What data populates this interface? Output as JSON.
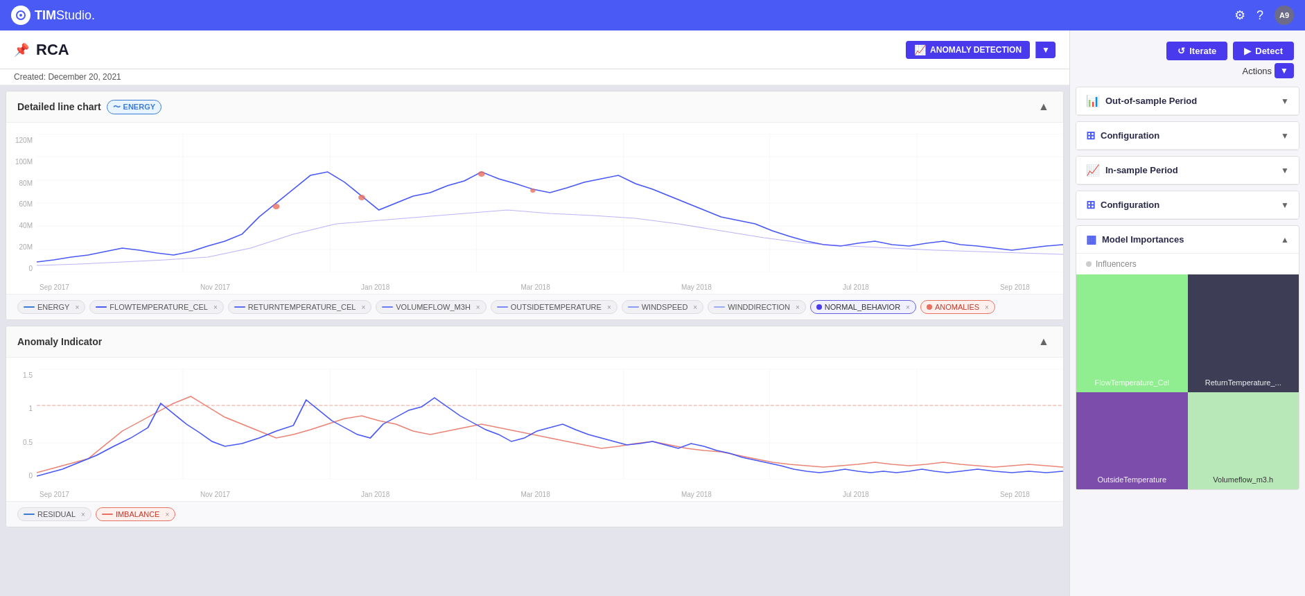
{
  "app": {
    "name": "TIM",
    "subtitle": "Studio.",
    "user_initials": "A9"
  },
  "header": {
    "title": "RCA",
    "created_label": "Created:",
    "created_date": "December 20, 2021",
    "anomaly_badge": "ANOMALY DETECTION",
    "iterate_label": "Iterate",
    "detect_label": "Detect",
    "actions_label": "Actions"
  },
  "charts": {
    "detailed_line_chart": {
      "title": "Detailed line chart",
      "tag": "ENERGY",
      "y_labels": [
        "120M",
        "100M",
        "80M",
        "60M",
        "40M",
        "20M",
        "0"
      ],
      "x_labels": [
        "Sep 2017",
        "Nov 2017",
        "Jan 2018",
        "Mar 2018",
        "May 2018",
        "Jul 2018",
        "Sep 2018"
      ],
      "legend": [
        {
          "label": "ENERGY",
          "color": "#3a7bd5",
          "type": "line"
        },
        {
          "label": "FLOWTEMPERATURE_CEL",
          "color": "#4a5af5",
          "type": "line"
        },
        {
          "label": "RETURNTEMPERATURE_CEL",
          "color": "#5a6af5",
          "type": "line"
        },
        {
          "label": "VOLUMEFLOW_M3H",
          "color": "#6a7af5",
          "type": "line"
        },
        {
          "label": "OUTSIDETEMPERATURE",
          "color": "#7a8af5",
          "type": "line"
        },
        {
          "label": "WINDSPEED",
          "color": "#8a9af5",
          "type": "line"
        },
        {
          "label": "WINDDIRECTION",
          "color": "#9aaaf5",
          "type": "line"
        },
        {
          "label": "NORMAL_BEHAVIOR",
          "color": "#4a3aed",
          "type": "fill"
        },
        {
          "label": "ANOMALIES",
          "color": "#e87060",
          "type": "fill"
        }
      ]
    },
    "anomaly_indicator": {
      "title": "Anomaly Indicator",
      "y_labels": [
        "1.5",
        "1",
        "0.5",
        "0"
      ],
      "x_labels": [
        "Sep 2017",
        "Nov 2017",
        "Jan 2018",
        "Mar 2018",
        "May 2018",
        "Jul 2018",
        "Sep 2018"
      ],
      "legend": [
        {
          "label": "RESIDUAL",
          "color": "#3a7bd5",
          "type": "line"
        },
        {
          "label": "IMBALANCE",
          "color": "#e87060",
          "type": "line"
        }
      ]
    }
  },
  "sidebar": {
    "sections": [
      {
        "id": "out-of-sample",
        "icon": "chart",
        "title": "Out-of-sample Period",
        "expanded": false
      },
      {
        "id": "config-oos",
        "icon": "grid",
        "title": "Configuration",
        "expanded": false
      },
      {
        "id": "in-sample",
        "icon": "chart-in",
        "title": "In-sample Period",
        "expanded": false
      },
      {
        "id": "config-is",
        "icon": "grid2",
        "title": "Configuration",
        "expanded": false
      },
      {
        "id": "model-importances",
        "icon": "bar",
        "title": "Model Importances",
        "expanded": true
      }
    ],
    "model_importances": {
      "influencers_label": "Influencers",
      "cells": [
        {
          "label": "FlowTemperature_Cel",
          "color": "#90ee90",
          "size": "large"
        },
        {
          "label": "ReturnTemperature_...",
          "color": "#444455",
          "size": "large"
        },
        {
          "label": "OutsideTemperature",
          "color": "#7c4daa",
          "size": "medium"
        },
        {
          "label": "Volumeflow_m3.h",
          "color": "#b8e8b8",
          "size": "medium"
        }
      ]
    }
  }
}
